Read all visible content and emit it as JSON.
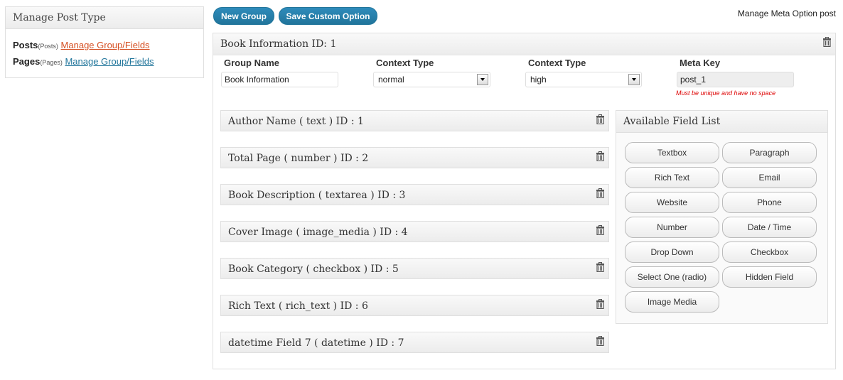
{
  "sidebar": {
    "title": "Manage Post Type",
    "items": [
      {
        "name": "Posts",
        "sub": "(Posts)",
        "link": "Manage Group/Fields"
      },
      {
        "name": "Pages",
        "sub": "(Pages)",
        "link": "Manage Group/Fields"
      }
    ]
  },
  "toolbar": {
    "new_group": "New Group",
    "save_custom": "Save Custom Option"
  },
  "page_title": "Manage Meta Option post",
  "group": {
    "title": "Book Information ID: 1",
    "group_name_label": "Group Name",
    "group_name_value": "Book Information",
    "context_label": "Context Type",
    "context_value": "normal",
    "priority_label": "Context Type",
    "priority_value": "high",
    "meta_key_label": "Meta Key",
    "meta_key_value": "post_1",
    "meta_key_note": "Must be unique and have no space"
  },
  "fields": [
    "Author Name ( text ) ID : 1",
    "Total Page ( number ) ID : 2",
    "Book Description ( textarea ) ID : 3",
    "Cover Image ( image_media ) ID : 4",
    "Book Category ( checkbox ) ID : 5",
    "Rich Text ( rich_text ) ID : 6",
    "datetime Field 7 ( datetime ) ID : 7"
  ],
  "available": {
    "title": "Available Field List",
    "items": [
      "Textbox",
      "Paragraph",
      "Rich Text",
      "Email",
      "Website",
      "Phone",
      "Number",
      "Date / Time",
      "Drop Down",
      "Checkbox",
      "Select One (radio)",
      "Hidden Field",
      "Image Media"
    ]
  },
  "icons": {
    "delete": "trash-icon"
  },
  "colors": {
    "link_red": "#d54e21",
    "link_blue": "#21759b",
    "button_blue": "#21759b",
    "warning": "#dd0000"
  }
}
